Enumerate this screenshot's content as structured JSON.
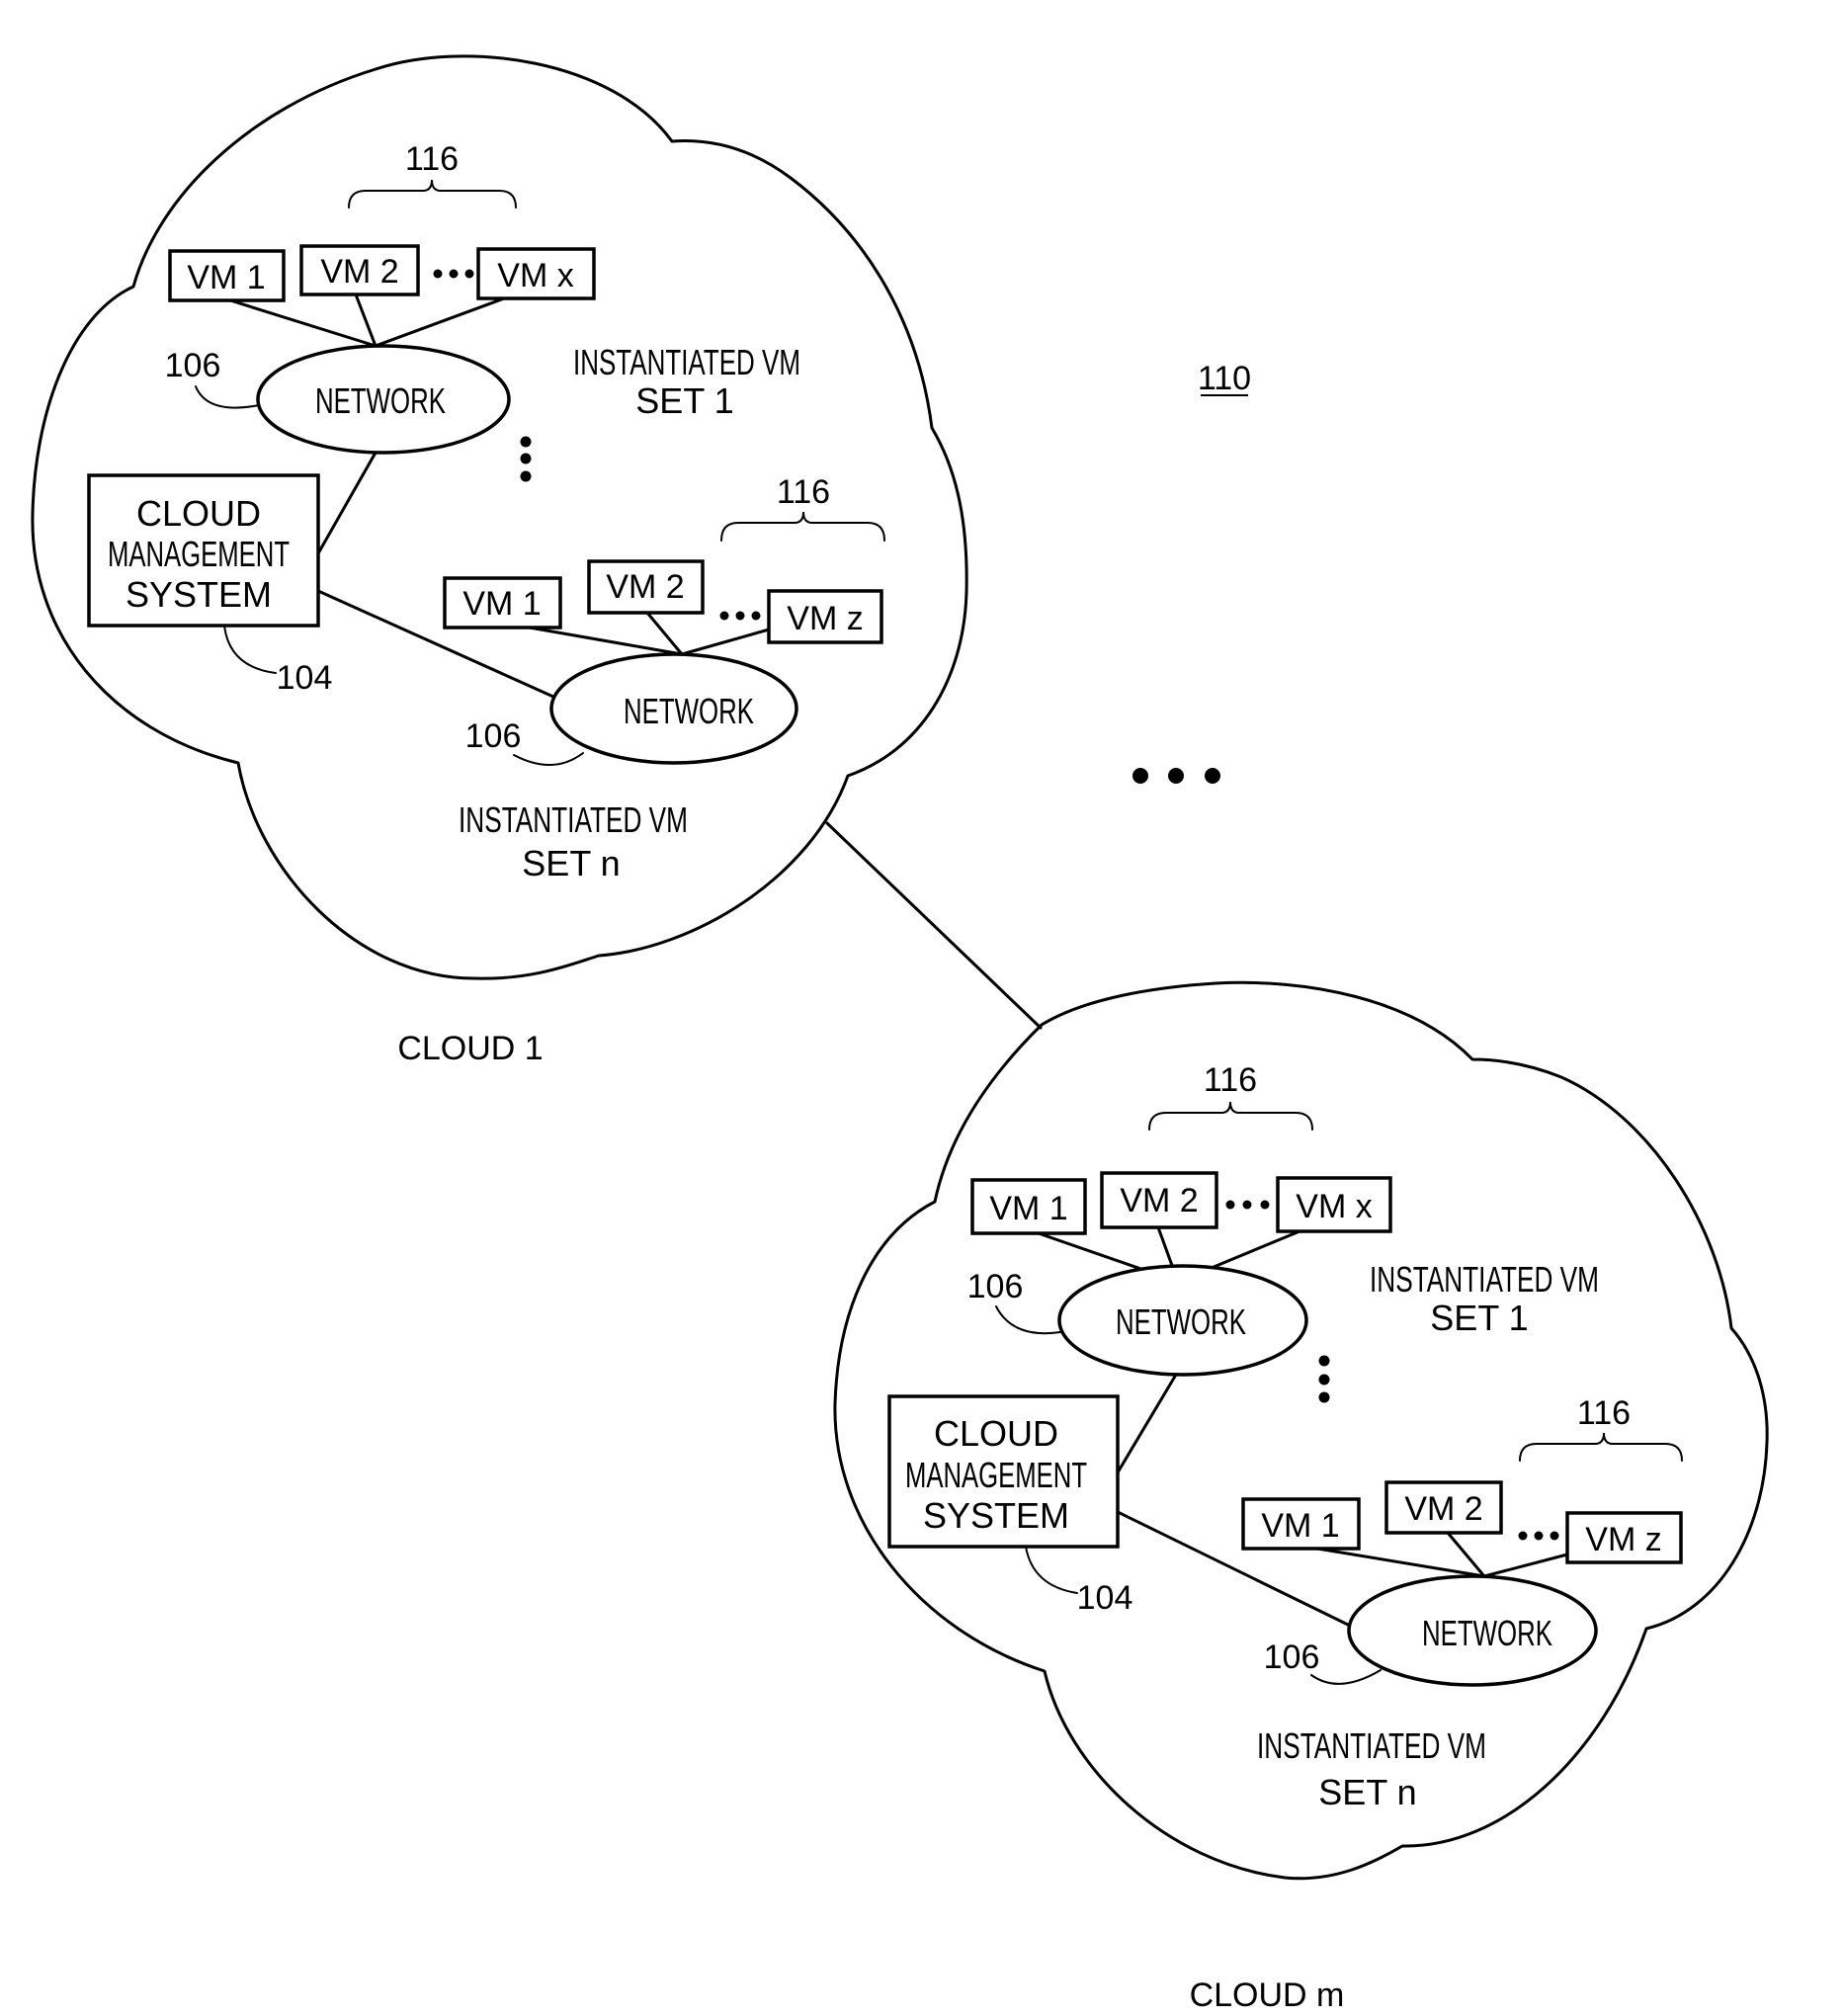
{
  "figure": {
    "reference_numeral": "110",
    "between_clouds_ellipsis": "•••"
  },
  "clouds": [
    {
      "label": "CLOUD 1",
      "cloud_management_system": {
        "lines": [
          "CLOUD",
          "MANAGEMENT",
          "SYSTEM"
        ],
        "ref": "104"
      },
      "vm_sets": [
        {
          "label_lines": [
            "INSTANTIATED VM",
            "SET 1"
          ],
          "network": {
            "label": "NETWORK",
            "ref": "106"
          },
          "group_ref": "116",
          "vms": [
            "VM 1",
            "VM 2",
            "VM x"
          ],
          "ellipsis": "•••"
        },
        {
          "label_lines": [
            "INSTANTIATED VM",
            "SET n"
          ],
          "network": {
            "label": "NETWORK",
            "ref": "106"
          },
          "group_ref": "116",
          "vms": [
            "VM 1",
            "VM 2",
            "VM z"
          ],
          "ellipsis": "•••"
        }
      ],
      "sets_ellipsis": "⋮"
    },
    {
      "label": "CLOUD m",
      "cloud_management_system": {
        "lines": [
          "CLOUD",
          "MANAGEMENT",
          "SYSTEM"
        ],
        "ref": "104"
      },
      "vm_sets": [
        {
          "label_lines": [
            "INSTANTIATED VM",
            "SET 1"
          ],
          "network": {
            "label": "NETWORK",
            "ref": "106"
          },
          "group_ref": "116",
          "vms": [
            "VM 1",
            "VM 2",
            "VM x"
          ],
          "ellipsis": "•••"
        },
        {
          "label_lines": [
            "INSTANTIATED VM",
            "SET n"
          ],
          "network": {
            "label": "NETWORK",
            "ref": "106"
          },
          "group_ref": "116",
          "vms": [
            "VM 1",
            "VM 2",
            "VM z"
          ],
          "ellipsis": "•••"
        }
      ],
      "sets_ellipsis": "⋮"
    }
  ]
}
